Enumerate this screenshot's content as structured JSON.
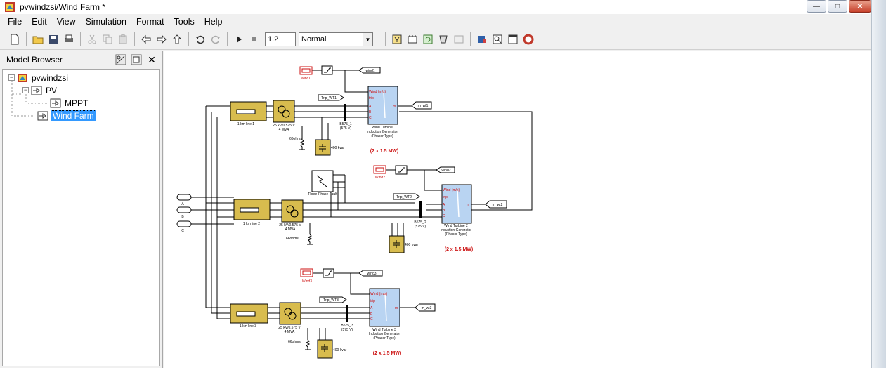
{
  "window": {
    "title": "pvwindzsi/Wind Farm *"
  },
  "menu": [
    "File",
    "Edit",
    "View",
    "Simulation",
    "Format",
    "Tools",
    "Help"
  ],
  "toolbar": {
    "stop_time": "1.2",
    "sim_mode": "Normal"
  },
  "browser": {
    "title": "Model Browser",
    "tree": [
      {
        "label": "pvwindzsi",
        "expander": "−",
        "level": 0
      },
      {
        "label": "PV",
        "expander": "−",
        "level": 1
      },
      {
        "label": "MPPT",
        "expander": "",
        "level": 2
      },
      {
        "label": "Wind Farm",
        "expander": "",
        "level": 1,
        "selected": true
      }
    ]
  },
  "diagram": {
    "sources": [
      "A",
      "B",
      "C"
    ],
    "wind_sources": [
      "Wind1",
      "Wind2",
      "Wind3"
    ],
    "wind_gotos": [
      "wind1",
      "wind2",
      "wind3"
    ],
    "trip_tags": [
      "Trip_WT1",
      "Trip_WT2",
      "Trip_WT3"
    ],
    "m_tags": [
      "m_wt1",
      "m_wt2",
      "m_wt3"
    ],
    "lines": [
      "1 km line 1",
      "1 km line 2",
      "1 km line 3"
    ],
    "transformer": [
      "25 kV/0.575 V",
      "4 MVA"
    ],
    "bus": [
      "B575_1",
      "B575_2",
      "B575_3"
    ],
    "bus_voltage": "(575 V)",
    "grounding": "66ohms",
    "capacitor": "400 kvar",
    "fault": "Three-Phase Fault",
    "turbines": [
      [
        "Wind Turbine",
        "Induction Generator",
        "(Phasor Type)"
      ],
      [
        "Wind Turbine 2",
        "Induction Generator",
        "(Phasor Type)"
      ],
      [
        "Wind Turbine 3",
        "Induction Generator",
        "(Phasor Type)"
      ]
    ],
    "turbine_ports": [
      "Wind (m/s)",
      "trip",
      "A",
      "B",
      "C",
      "m"
    ],
    "rating": "(2 x 1.5 MW)",
    "colors": {
      "block_yellow": "#d8bc4e",
      "turbine_blue": "#b9d4f2",
      "source_red": "#cc1111",
      "rating_red": "#cc1111"
    }
  }
}
